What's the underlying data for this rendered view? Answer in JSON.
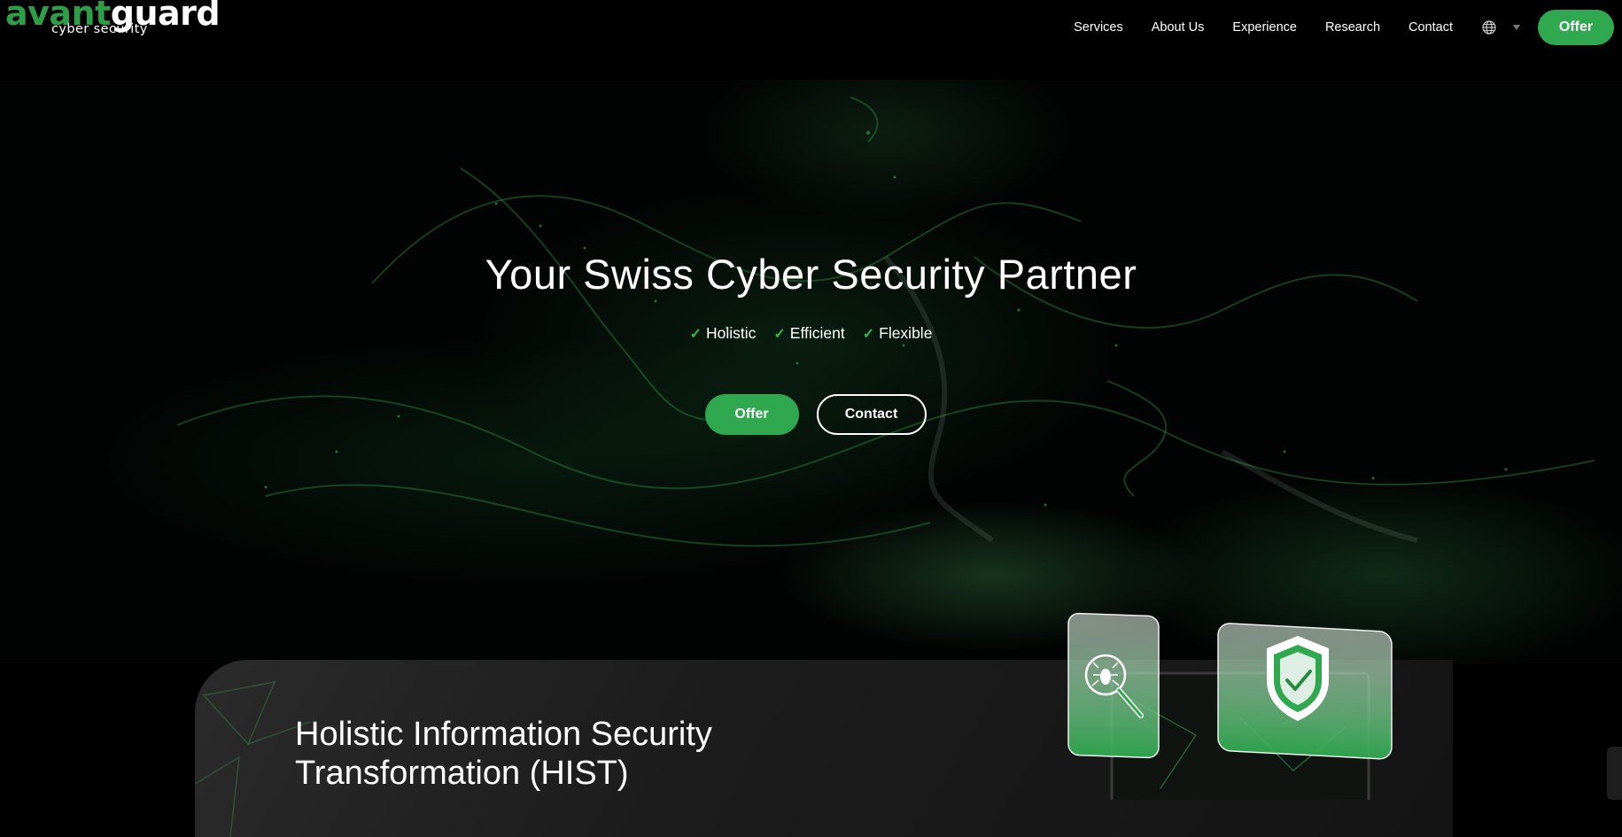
{
  "header": {
    "logo": {
      "part1": "avant",
      "part2": "guard",
      "sub": "cyber security"
    },
    "nav": [
      "Services",
      "About Us",
      "Experience",
      "Research",
      "Contact"
    ],
    "language_icon": "globe-icon",
    "offer_label": "Offer"
  },
  "hero": {
    "title": "Your Swiss Cyber Security Partner",
    "features": [
      "Holistic",
      "Efficient",
      "Flexible"
    ],
    "primary_button": "Offer",
    "secondary_button": "Contact"
  },
  "card": {
    "title_line1": "Holistic Information Security",
    "title_line2": "Transformation (HIST)"
  },
  "colors": {
    "accent": "#2fa84f",
    "background": "#000000",
    "logo_green": "#2e9e46"
  }
}
